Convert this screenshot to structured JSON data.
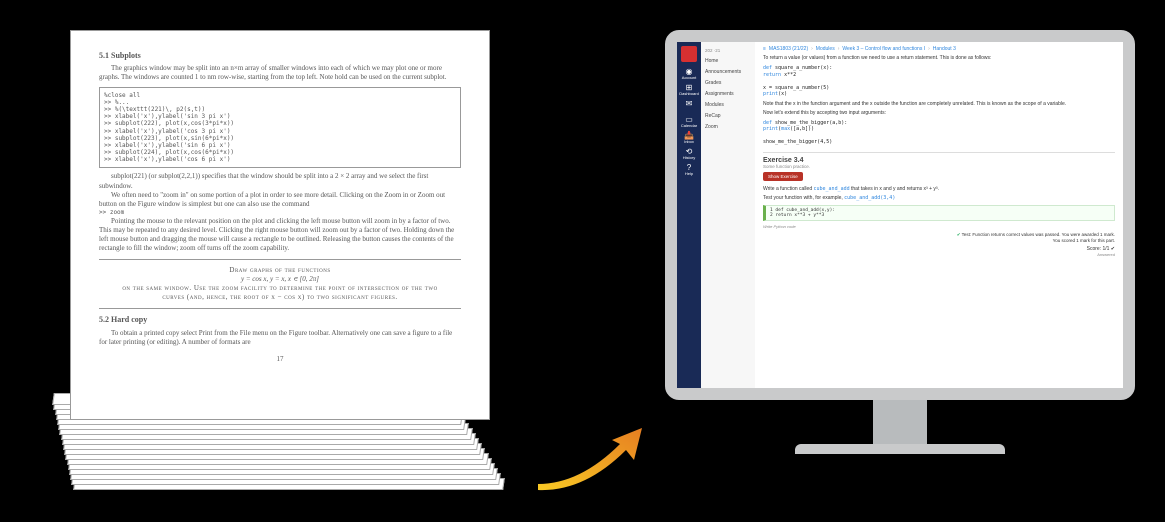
{
  "paper": {
    "section1_title": "5.1   Subplots",
    "para1": "The graphics window may be split into an n×m array of smaller windows into each of which we may plot one or more graphs. The windows are counted 1 to nm row-wise, starting from the top left. Note hold can be used on the current subplot.",
    "code_lines": [
      "%close all",
      ">> %...",
      ">> %(\\texttt(221)\\, p2(s,t))",
      ">>    xlabel('x'),ylabel('sin 3 pi x')",
      ">> subplot(222), plot(x,cos(3*pi*x))",
      ">>    xlabel('x'),ylabel('cos 3 pi x')",
      ">> subplot(223), plot(x,sin(6*pi*x))",
      ">>    xlabel('x'),ylabel('sin 6 pi x')",
      ">> subplot(224), plot(x,cos(6*pi*x))",
      ">>    xlabel('x'),ylabel('cos 6 pi x')"
    ],
    "para2": "subplot(221) (or subplot(2,2,1)) specifies that the window should be split into a 2 × 2 array and we select the first subwindow.",
    "para3": "We often need to \"zoom in\" on some portion of a plot in order to see more detail. Clicking on the Zoom in or Zoom out button on the Figure window is simplest but one can also use the command",
    "zoom": ">> zoom",
    "para4": "Pointing the mouse to the relevant position on the plot and clicking the left mouse button will zoom in by a factor of two. This may be repeated to any desired level. Clicking the right mouse button will zoom out by a factor of two. Holding down the left mouse button and dragging the mouse will cause a rectangle to be outlined. Releasing the button causes the contents of the rectangle to fill the window; zoom off turns off the zoom capability.",
    "exercise_title": "Draw graphs of the functions",
    "exercise_eq": "y = cos x,    y = x,    x ∊ [0, 2π]",
    "exercise_hint": "on the same window.  Use the zoom facility to determine the point of intersection of the two curves (and, hence, the root of x − cos x) to two significant figures.",
    "section2_title": "5.2   Hard copy",
    "para5": "To obtain a printed copy select Print from the File menu on the Figure toolbar. Alternatively one can save a figure to a file for later printing (or editing). A number of formats are",
    "pagenum": "17"
  },
  "lms": {
    "iconbar": [
      {
        "glyph": "◉",
        "label": "Account"
      },
      {
        "glyph": "⊞",
        "label": "Dashboard"
      },
      {
        "glyph": "✉",
        "label": ""
      },
      {
        "glyph": "▭",
        "label": "Calendar"
      },
      {
        "glyph": "📥",
        "label": "Inbox"
      },
      {
        "glyph": "⟲",
        "label": "History"
      },
      {
        "glyph": "?",
        "label": "Help"
      }
    ],
    "coursemenu": {
      "title": "202 ·21",
      "items": [
        "Home",
        "Announcements",
        "Grades",
        "Assignments",
        "Modules",
        "ReCap",
        "Zoom"
      ]
    },
    "breadcrumb": [
      "MAS1803 (21/22)",
      "Modules",
      "Week 3 – Control flow and functions I",
      "Handout 3"
    ],
    "line_intro": "To return a value (or values) from a function we need to use a  return  statement. This is done as follows:",
    "code1": [
      "def square_a_number(x):",
      "    return x**2",
      "",
      "x = square_a_number(5)",
      "print(x)"
    ],
    "line_scope": "Note that the  x  in the function argument and the  x  outside the function are completely unrelated. This is known as the scope of a variable.",
    "line_extend": "Now let's extend this by accepting two input arguments:",
    "code2": [
      "def show_me_the_bigger(a,b):",
      "    print(max([a,b]))",
      "",
      "show_me_the_bigger(4,5)"
    ],
    "exercise_title": "Exercise 3.4",
    "exercise_sub": "Some function practice.",
    "show_btn": "Show Exercise",
    "task1a": "Write a function called ",
    "task1_func": "cube_and_add",
    "task1b": " that takes in x and y and returns x³ + y³.",
    "task2a": "Test your function with, for example, ",
    "task2_call": "cube_and_add(3,4)",
    "usercode": [
      "1  def cube_and_add(x,y):",
      "2      return x**3 + y**3"
    ],
    "pyhint": "Write Python code",
    "pass_msg": "Test: Function returns correct values was passed. You were awarded 1 mark.",
    "award_msg": "You scored 1 mark for this part.",
    "score": "Score: 1/1",
    "answered": "Answered"
  }
}
